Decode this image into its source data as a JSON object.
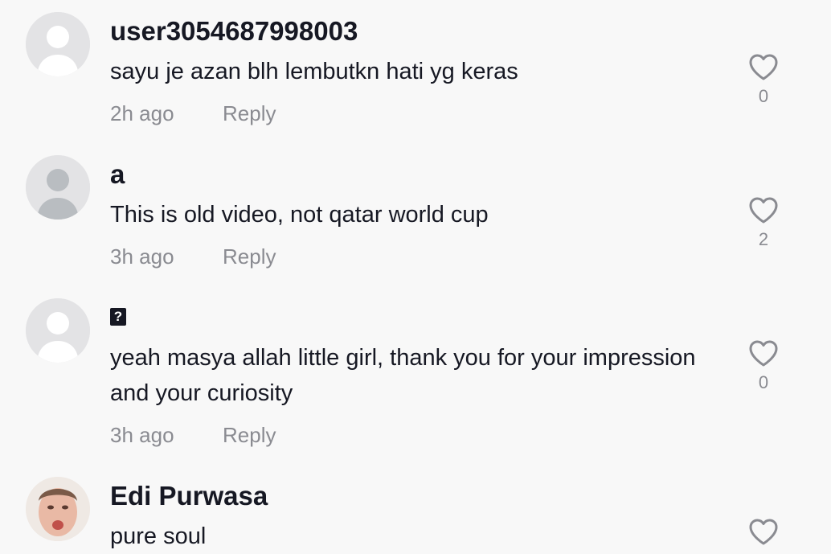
{
  "comments": [
    {
      "username": "user3054687998003",
      "text": "sayu je azan blh lembutkn hati yg keras",
      "time": "2h ago",
      "reply_label": "Reply",
      "like_count": "0",
      "avatar": "default-avatar-icon"
    },
    {
      "username": "a",
      "text": "This is old video, not qatar world cup",
      "time": "3h ago",
      "reply_label": "Reply",
      "like_count": "2",
      "avatar": "default-avatar-icon"
    },
    {
      "username": "?",
      "text": "yeah masya allah little girl, thank you for your impression and your curiosity",
      "time": "3h ago",
      "reply_label": "Reply",
      "like_count": "0",
      "avatar": "default-avatar-icon"
    },
    {
      "username": "Edi Purwasa",
      "text": "pure soul",
      "avatar": "profile-photo"
    }
  ],
  "colors": {
    "background": "#f8f8f8",
    "primary_text": "#161823",
    "secondary_text": "#8a8b91",
    "avatar_bg": "#e3e3e5",
    "avatar_silhouette_white": "#ffffff",
    "avatar_silhouette_grey": "#b9bdc1"
  },
  "icons": {
    "like": "heart-outline-icon"
  }
}
